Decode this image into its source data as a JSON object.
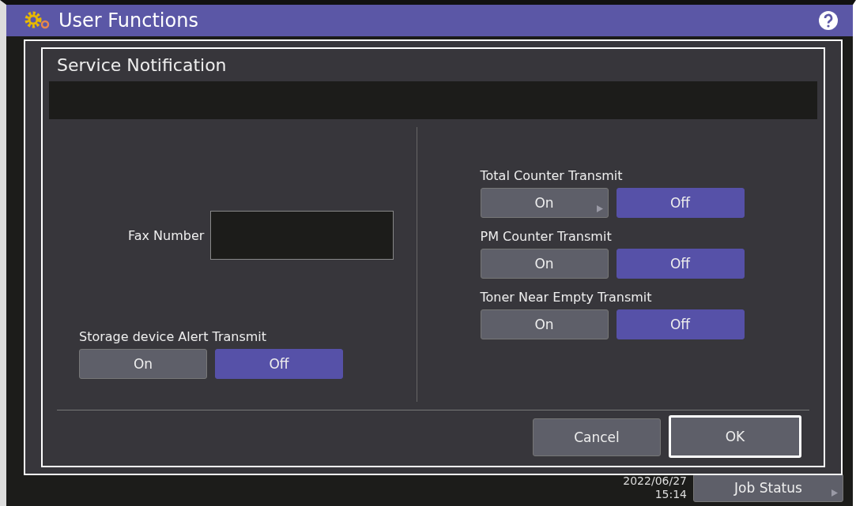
{
  "app": {
    "title": "User Functions"
  },
  "dialog": {
    "title": "Service Notification",
    "fax": {
      "label": "Fax Number"
    },
    "left_toggles": [
      {
        "label": "Storage device Alert Transmit",
        "options": [
          {
            "label": "On",
            "selected": false,
            "arrow": false
          },
          {
            "label": "Off",
            "selected": true,
            "arrow": false
          }
        ]
      }
    ],
    "right_toggles": [
      {
        "label": "Total Counter Transmit",
        "options": [
          {
            "label": "On",
            "selected": false,
            "arrow": true
          },
          {
            "label": "Off",
            "selected": true,
            "arrow": false
          }
        ]
      },
      {
        "label": "PM Counter Transmit",
        "options": [
          {
            "label": "On",
            "selected": false,
            "arrow": false
          },
          {
            "label": "Off",
            "selected": true,
            "arrow": false
          }
        ]
      },
      {
        "label": "Toner Near Empty Transmit",
        "options": [
          {
            "label": "On",
            "selected": false,
            "arrow": false
          },
          {
            "label": "Off",
            "selected": true,
            "arrow": false
          }
        ]
      }
    ],
    "buttons": [
      {
        "label": "Cancel",
        "focused": false
      },
      {
        "label": "OK",
        "focused": true
      }
    ]
  },
  "status_bar": {
    "date": "2022/06/27",
    "time": "15:14",
    "job_status": "Job Status"
  }
}
